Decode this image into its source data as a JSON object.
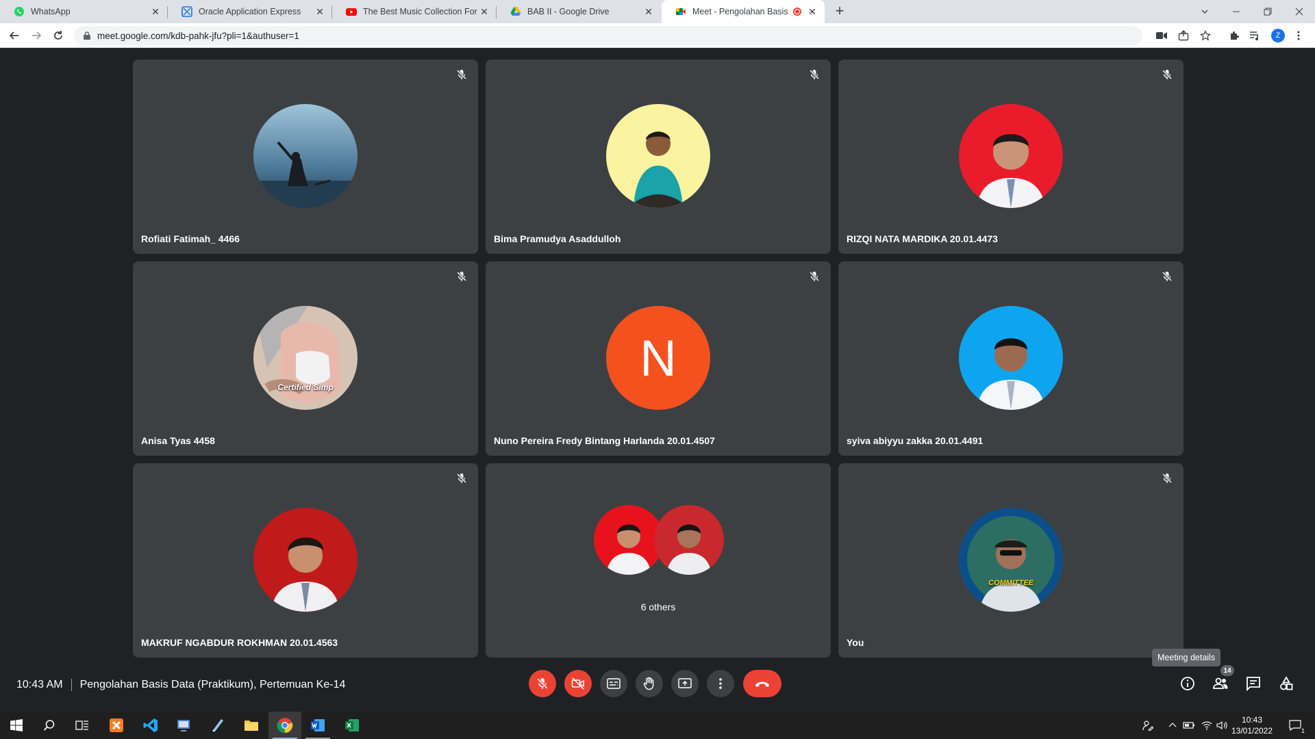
{
  "browser": {
    "tabs": [
      {
        "label": "WhatsApp",
        "icon": "whatsapp-icon",
        "active": false
      },
      {
        "label": "Oracle Application Express",
        "icon": "apex-icon",
        "active": false
      },
      {
        "label": "The Best Music Collection For St",
        "icon": "youtube-icon",
        "active": false
      },
      {
        "label": "BAB II - Google Drive",
        "icon": "drive-icon",
        "active": false
      },
      {
        "label": "Meet - Pengolahan Basis Dat",
        "icon": "meet-icon",
        "active": true
      }
    ],
    "new_tab_label": "+",
    "url": "meet.google.com/kdb-pahk-jfu?pli=1&authuser=1",
    "profile_initial": "Z"
  },
  "meet": {
    "participants": [
      {
        "name": "Rofiati Fatimah_ 4466",
        "avatar": "photo-sky",
        "muted": true
      },
      {
        "name": "Bima Pramudya Asaddulloh",
        "avatar": "photo-yellow",
        "muted": true
      },
      {
        "name": "RIZQI NATA MARDIKA 20.01.4473",
        "avatar": "photo-red",
        "muted": true
      },
      {
        "name": "Anisa Tyas 4458",
        "avatar": "photo-selfie",
        "muted": true,
        "avatar_caption": "Certified Simp"
      },
      {
        "name": "Nuno Pereira Fredy Bintang Harlanda 20.01.4507",
        "avatar": "letter",
        "letter": "N",
        "muted": true
      },
      {
        "name": "syiva abiyyu zakka 20.01.4491",
        "avatar": "photo-blue",
        "muted": true
      },
      {
        "name": "MAKRUF NGABDUR ROKHMAN 20.01.4563",
        "avatar": "photo-red2",
        "muted": true
      },
      {
        "name": "You",
        "avatar": "photo-committee",
        "muted": true,
        "avatar_caption": "COMMITTEE"
      }
    ],
    "others_label": "6 others",
    "time": "10:43 AM",
    "meeting_title": "Pengolahan Basis Data (Praktikum), Pertemuan Ke-14",
    "tooltip": "Meeting details",
    "people_count": "14",
    "colors": {
      "danger": "#ea4335",
      "tile": "#3c4043",
      "background": "#202124",
      "letter_avatar": "#f4511e"
    }
  },
  "taskbar": {
    "time": "10:43",
    "date": "13/01/2022",
    "notification_count": "1"
  }
}
